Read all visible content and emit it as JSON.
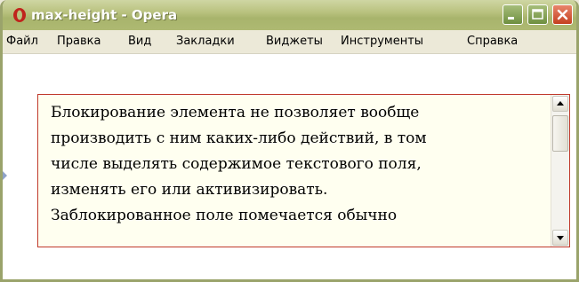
{
  "window": {
    "title": "max-height - Opera",
    "icon": "opera-logo-icon"
  },
  "menu": [
    "Файл",
    "Правка",
    "Вид",
    "Закладки",
    "Виджеты",
    "Инструменты",
    "Справка"
  ],
  "textarea": {
    "text": "Блокирование элемента не позволяет вообще\nпроизводить с ним каких-либо действий, в том\nчисле выделять содержимое текстового поля,\nизменять его или активизировать.\nЗаблокированное поле помечается обычно"
  },
  "colors": {
    "titlebar": "#b9c27f",
    "textarea_border": "#c0392b",
    "textarea_background": "#fffff0",
    "close_button": "#c4401f"
  }
}
